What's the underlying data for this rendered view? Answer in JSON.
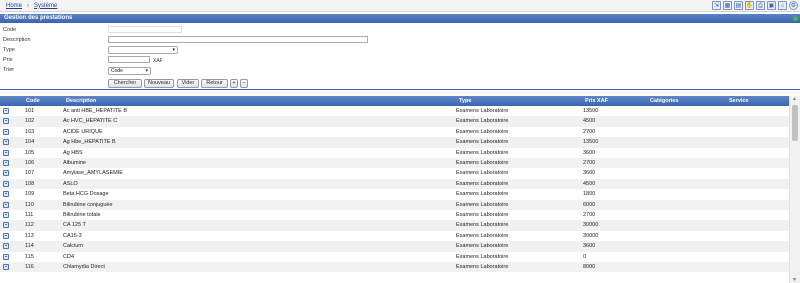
{
  "breadcrumb": {
    "home": "Home",
    "separator": "›",
    "current": "Système"
  },
  "toolbar_icons": [
    "export-icon",
    "grid-icon",
    "document-icon",
    "hand-icon",
    "print-icon",
    "lock-icon",
    "home-icon",
    "settings-icon"
  ],
  "panel": {
    "title": "Gestion des prestations"
  },
  "form": {
    "code_label": "Code",
    "description_label": "Description",
    "type_label": "Type",
    "prix_label": "Prix",
    "prix_unit": "XAF",
    "trier_label": "Trier",
    "trier_value": "Code",
    "buttons": [
      "Chercher",
      "Nouveau",
      "Vider",
      "Retour",
      "+",
      "–"
    ]
  },
  "table": {
    "columns": [
      "Code",
      "Description",
      "Type",
      "Prix XAF",
      "Catégories",
      "Service"
    ],
    "rows": [
      {
        "code": "101",
        "description": "Ac anti HBE_HEPATITE B",
        "type": "Examens Laboratoire",
        "prix": "13500"
      },
      {
        "code": "102",
        "description": "Ac HVC_HEPATITE C",
        "type": "Examens Laboratoire",
        "prix": "4500"
      },
      {
        "code": "103",
        "description": "ACIDE URIQUE",
        "type": "Examens Laboratoire",
        "prix": "2700"
      },
      {
        "code": "104",
        "description": "Ag Hbe_HEPATITE B",
        "type": "Examens Laboratoire",
        "prix": "13500"
      },
      {
        "code": "105",
        "description": "Ag HBS",
        "type": "Examens Laboratoire",
        "prix": "3600"
      },
      {
        "code": "106",
        "description": "Albumine",
        "type": "Examens Laboratoire",
        "prix": "2700"
      },
      {
        "code": "107",
        "description": "Amylase_AMYLASEMIE",
        "type": "Examens Laboratoire",
        "prix": "3600"
      },
      {
        "code": "108",
        "description": "ASLO",
        "type": "Examens Laboratoire",
        "prix": "4500"
      },
      {
        "code": "109",
        "description": "Beta HCG Dosage",
        "type": "Examens Laboratoire",
        "prix": "1800"
      },
      {
        "code": "110",
        "description": "Bilirubine conjuguée",
        "type": "Examens Laboratoire",
        "prix": "6000"
      },
      {
        "code": "111",
        "description": "Bilirubine totale",
        "type": "Examens Laboratoire",
        "prix": "2700"
      },
      {
        "code": "112",
        "description": "CA 125 T",
        "type": "Examens Laboratoire",
        "prix": "30000"
      },
      {
        "code": "113",
        "description": "CA15-3",
        "type": "Examens Laboratoire",
        "prix": "30000"
      },
      {
        "code": "114",
        "description": "Calcium",
        "type": "Examens Laboratoire",
        "prix": "3600"
      },
      {
        "code": "115",
        "description": "CD4",
        "type": "Examens Laboratoire",
        "prix": "0"
      },
      {
        "code": "116",
        "description": "Chlamydia Direct",
        "type": "Examens Laboratoire",
        "prix": "8000"
      }
    ]
  }
}
